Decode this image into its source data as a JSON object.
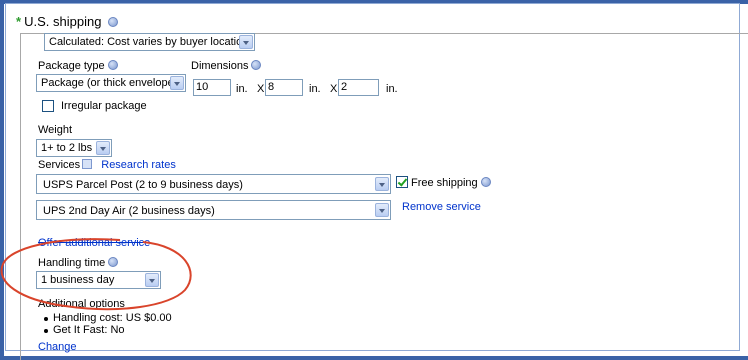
{
  "section": {
    "required_mark": "*",
    "title": "U.S. shipping",
    "cost_type_select": "Calculated: Cost varies by buyer location"
  },
  "package": {
    "type_label": "Package type",
    "type_select": "Package (or thick envelope)",
    "dimensions_label": "Dimensions",
    "length": "10",
    "width": "8",
    "height": "2",
    "unit_in_1": "in.",
    "times_1": "X",
    "unit_in_2": "in.",
    "times_2": "X",
    "unit_in_3": "in.",
    "irregular_label": "Irregular package"
  },
  "weight": {
    "label": "Weight",
    "select": "1+ to 2 lbs"
  },
  "services": {
    "label": "Services",
    "research_link": "Research rates",
    "service_1": "USPS Parcel Post  (2 to 9 business days)",
    "free_shipping_label": "Free shipping",
    "service_2": "UPS 2nd Day Air  (2 business days)",
    "remove_link": "Remove service",
    "offer_link": "Offer additional service"
  },
  "handling": {
    "label": "Handling time",
    "select": "1 business day"
  },
  "additional": {
    "label": "Additional options",
    "item_1": "Handling cost: US $0.00",
    "item_2": "Get It Fast: No",
    "change_link": "Change"
  },
  "colors": {
    "frame": "#3a62a7",
    "link": "#0033cc",
    "annotation_circle": "#d9442b",
    "required": "#2f9b2f"
  },
  "icons": [
    "help-icon",
    "research-rates-icon",
    "chevron-down-icon",
    "checkmark-icon"
  ]
}
